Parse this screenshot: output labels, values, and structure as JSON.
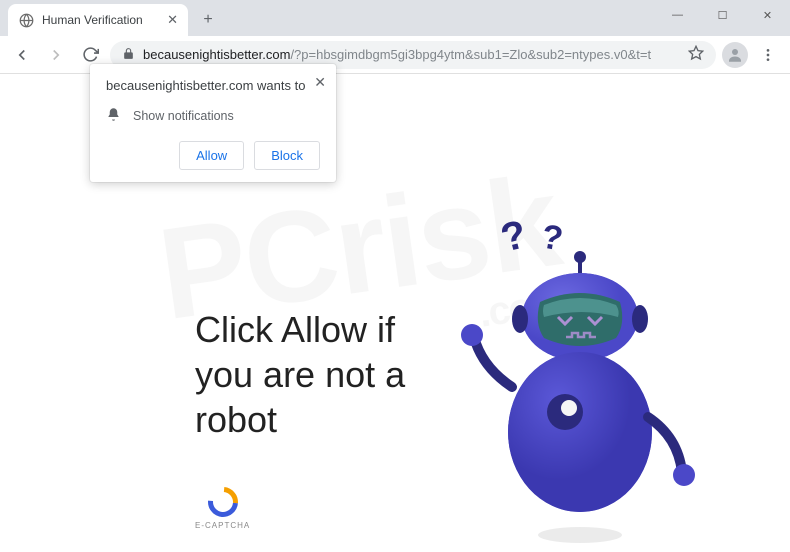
{
  "window": {
    "tab_title": "Human Verification",
    "url_host": "becausenightisbetter.com",
    "url_path": "/?p=hbsgimdbgm5gi3bpg4ytm&sub1=Zlo&sub2=ntypes.v0&t=t"
  },
  "prompt": {
    "origin_wants_to": "becausenightisbetter.com wants to",
    "permission_label": "Show notifications",
    "allow_label": "Allow",
    "block_label": "Block"
  },
  "page": {
    "headline_l1": "Click Allow if",
    "headline_l2": "you are not a",
    "headline_l3": "robot",
    "captcha_brand": "E-CAPTCHA"
  },
  "watermark": {
    "big": "PCrisk",
    "small": ".com"
  },
  "colors": {
    "robot_body": "#4b48c8",
    "robot_dark": "#2b2a7d",
    "accent_blue": "#1a73e8"
  }
}
